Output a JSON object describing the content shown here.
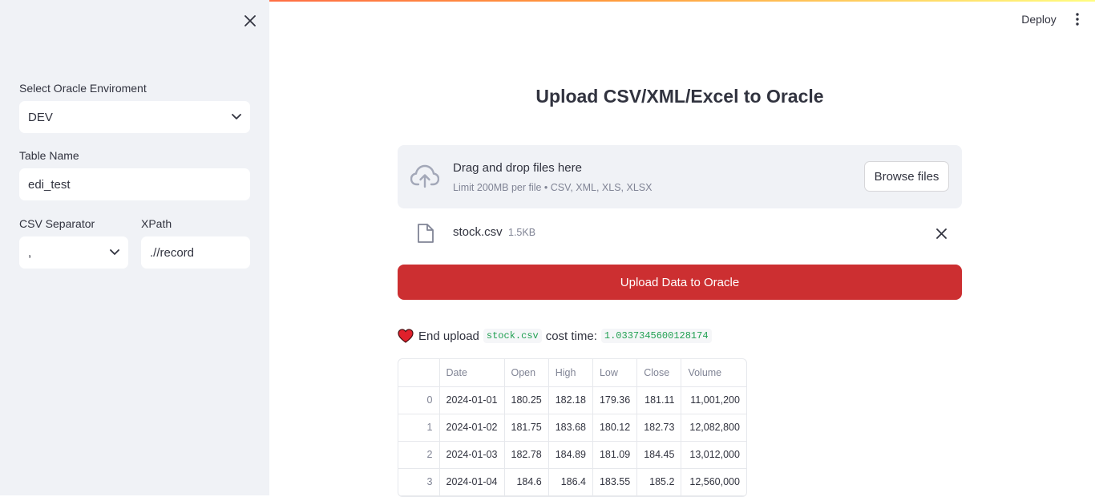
{
  "header": {
    "deploy_label": "Deploy",
    "menu_icon": "kebab-menu-icon"
  },
  "sidebar": {
    "env_label": "Select Oracle Enviroment",
    "env_value": "DEV",
    "table_label": "Table Name",
    "table_value": "edi_test",
    "separator_label": "CSV Separator",
    "separator_value": ",",
    "xpath_label": "XPath",
    "xpath_value": ".//record"
  },
  "main": {
    "title": "Upload CSV/XML/Excel to Oracle",
    "uploader": {
      "drop_text": "Drag and drop files here",
      "limit_text": "Limit 200MB per file • CSV, XML, XLS, XLSX",
      "browse_label": "Browse files"
    },
    "file": {
      "name": "stock.csv",
      "size": "1.5KB"
    },
    "upload_button": "Upload Data to Oracle",
    "status": {
      "prefix": "End upload",
      "file": "stock.csv",
      "cost_label": "cost time:",
      "cost_value": "1.0337345600128174"
    },
    "table": {
      "columns": [
        "",
        "Date",
        "Open",
        "High",
        "Low",
        "Close",
        "Volume"
      ],
      "rows": [
        [
          "0",
          "2024-01-01",
          "180.25",
          "182.18",
          "179.36",
          "181.11",
          "11,001,200"
        ],
        [
          "1",
          "2024-01-02",
          "181.75",
          "183.68",
          "180.12",
          "182.73",
          "12,082,800"
        ],
        [
          "2",
          "2024-01-03",
          "182.78",
          "184.89",
          "181.09",
          "184.45",
          "13,012,000"
        ],
        [
          "3",
          "2024-01-04",
          "184.6",
          "186.4",
          "183.55",
          "185.2",
          "12,560,000"
        ]
      ]
    }
  },
  "colors": {
    "accent": "#ff4b4b",
    "primary_button": "#cc2f31",
    "code_text": "#21a052",
    "sidebar_bg": "#f0f2f6"
  }
}
